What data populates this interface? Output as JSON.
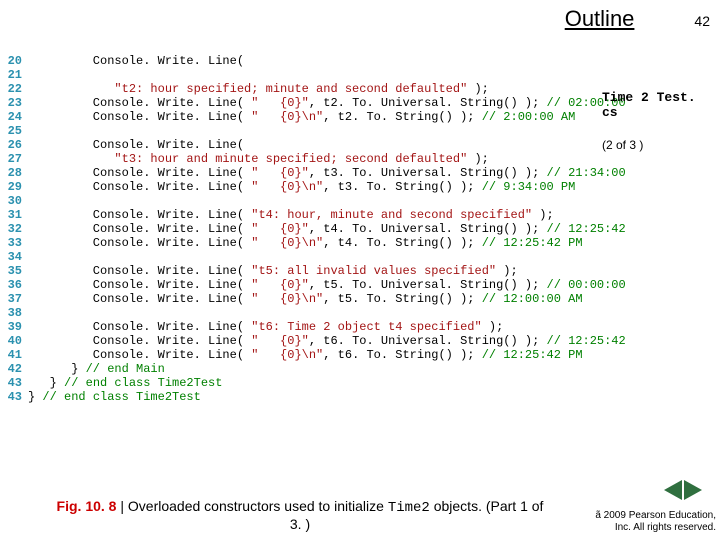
{
  "header": {
    "outline": "Outline",
    "page": "42"
  },
  "sidebar": {
    "filename": "Time 2 Test. cs",
    "range": "(2 of 3 )"
  },
  "caption": {
    "label": "Fig. 10. 8",
    "sep": " | ",
    "text1": "Overloaded constructors used to initialize ",
    "mono": "Time2",
    "text2": " objects. (Part 1 of 3. )"
  },
  "copyright": {
    "l1": "ã 2009 Pearson Education,",
    "l2": "Inc.  All rights reserved."
  },
  "code": [
    {
      "n": "20",
      "t": [
        {
          "p": "         Console. Write. Line(",
          "c": "k"
        }
      ]
    },
    {
      "n": "21",
      "t": []
    },
    {
      "n": "22",
      "t": [
        {
          "p": "            \"t2: hour specified; minute and second defaulted\"",
          "c": "s"
        },
        {
          "p": " );",
          "c": "k"
        }
      ]
    },
    {
      "n": "23",
      "t": [
        {
          "p": "         Console. Write. Line( ",
          "c": "k"
        },
        {
          "p": "\"   {0}\"",
          "c": "s"
        },
        {
          "p": ", t2. To. Universal. String() ); ",
          "c": "k"
        },
        {
          "p": "// 02:00:00",
          "c": "c"
        }
      ]
    },
    {
      "n": "24",
      "t": [
        {
          "p": "         Console. Write. Line( ",
          "c": "k"
        },
        {
          "p": "\"   {0}\\n\"",
          "c": "s"
        },
        {
          "p": ", t2. To. String() ); ",
          "c": "k"
        },
        {
          "p": "// 2:00:00 AM",
          "c": "c"
        }
      ]
    },
    {
      "n": "25",
      "t": []
    },
    {
      "n": "26",
      "t": [
        {
          "p": "         Console. Write. Line(",
          "c": "k"
        }
      ]
    },
    {
      "n": "27",
      "t": [
        {
          "p": "            \"t3: hour and minute specified; second defaulted\"",
          "c": "s"
        },
        {
          "p": " );",
          "c": "k"
        }
      ]
    },
    {
      "n": "28",
      "t": [
        {
          "p": "         Console. Write. Line( ",
          "c": "k"
        },
        {
          "p": "\"   {0}\"",
          "c": "s"
        },
        {
          "p": ", t3. To. Universal. String() ); ",
          "c": "k"
        },
        {
          "p": "// 21:34:00",
          "c": "c"
        }
      ]
    },
    {
      "n": "29",
      "t": [
        {
          "p": "         Console. Write. Line( ",
          "c": "k"
        },
        {
          "p": "\"   {0}\\n\"",
          "c": "s"
        },
        {
          "p": ", t3. To. String() ); ",
          "c": "k"
        },
        {
          "p": "// 9:34:00 PM",
          "c": "c"
        }
      ]
    },
    {
      "n": "30",
      "t": []
    },
    {
      "n": "31",
      "t": [
        {
          "p": "         Console. Write. Line( ",
          "c": "k"
        },
        {
          "p": "\"t4: hour, minute and second specified\"",
          "c": "s"
        },
        {
          "p": " );",
          "c": "k"
        }
      ]
    },
    {
      "n": "32",
      "t": [
        {
          "p": "         Console. Write. Line( ",
          "c": "k"
        },
        {
          "p": "\"   {0}\"",
          "c": "s"
        },
        {
          "p": ", t4. To. Universal. String() ); ",
          "c": "k"
        },
        {
          "p": "// 12:25:42",
          "c": "c"
        }
      ]
    },
    {
      "n": "33",
      "t": [
        {
          "p": "         Console. Write. Line( ",
          "c": "k"
        },
        {
          "p": "\"   {0}\\n\"",
          "c": "s"
        },
        {
          "p": ", t4. To. String() ); ",
          "c": "k"
        },
        {
          "p": "// 12:25:42 PM",
          "c": "c"
        }
      ]
    },
    {
      "n": "34",
      "t": []
    },
    {
      "n": "35",
      "t": [
        {
          "p": "         Console. Write. Line( ",
          "c": "k"
        },
        {
          "p": "\"t5: all invalid values specified\"",
          "c": "s"
        },
        {
          "p": " );",
          "c": "k"
        }
      ]
    },
    {
      "n": "36",
      "t": [
        {
          "p": "         Console. Write. Line( ",
          "c": "k"
        },
        {
          "p": "\"   {0}\"",
          "c": "s"
        },
        {
          "p": ", t5. To. Universal. String() ); ",
          "c": "k"
        },
        {
          "p": "// 00:00:00",
          "c": "c"
        }
      ]
    },
    {
      "n": "37",
      "t": [
        {
          "p": "         Console. Write. Line( ",
          "c": "k"
        },
        {
          "p": "\"   {0}\\n\"",
          "c": "s"
        },
        {
          "p": ", t5. To. String() ); ",
          "c": "k"
        },
        {
          "p": "// 12:00:00 AM",
          "c": "c"
        }
      ]
    },
    {
      "n": "38",
      "t": []
    },
    {
      "n": "39",
      "t": [
        {
          "p": "         Console. Write. Line( ",
          "c": "k"
        },
        {
          "p": "\"t6: Time 2 object t4 specified\"",
          "c": "s"
        },
        {
          "p": " );",
          "c": "k"
        }
      ]
    },
    {
      "n": "40",
      "t": [
        {
          "p": "         Console. Write. Line( ",
          "c": "k"
        },
        {
          "p": "\"   {0}\"",
          "c": "s"
        },
        {
          "p": ", t6. To. Universal. String() ); ",
          "c": "k"
        },
        {
          "p": "// 12:25:42",
          "c": "c"
        }
      ]
    },
    {
      "n": "41",
      "t": [
        {
          "p": "         Console. Write. Line( ",
          "c": "k"
        },
        {
          "p": "\"   {0}\\n\"",
          "c": "s"
        },
        {
          "p": ", t6. To. String() ); ",
          "c": "k"
        },
        {
          "p": "// 12:25:42 PM",
          "c": "c"
        }
      ]
    },
    {
      "n": "42",
      "t": [
        {
          "p": "      } ",
          "c": "k"
        },
        {
          "p": "// end Main",
          "c": "c"
        }
      ]
    },
    {
      "n": "43",
      "t": [
        {
          "p": "   } ",
          "c": "k"
        },
        {
          "p": "// end class Time2Test",
          "c": "c"
        }
      ]
    },
    {
      "n": "43",
      "t": [
        {
          "p": "} ",
          "c": "k"
        },
        {
          "p": "// end class Time2Test",
          "c": "c"
        }
      ]
    }
  ]
}
